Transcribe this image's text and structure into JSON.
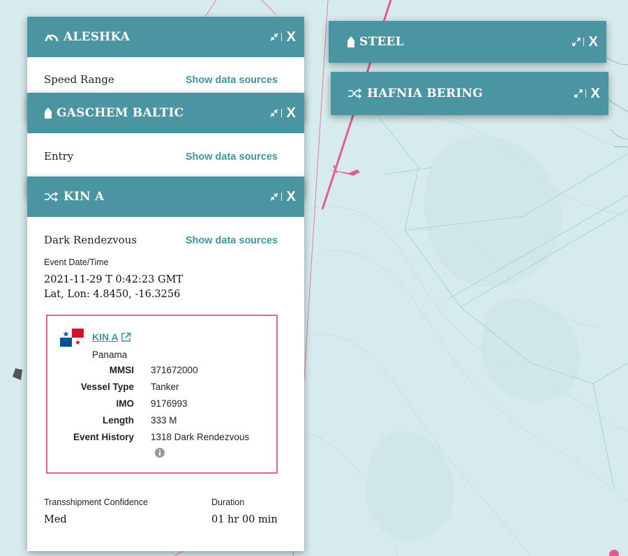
{
  "colors": {
    "header": "#4a95a1",
    "link": "#3f95a1",
    "highlight_border": "#e7609a",
    "map_water": "#d7eced"
  },
  "panels": {
    "aleshka": {
      "title": "ALESHKA",
      "icon": "speed-gauge-icon",
      "event_type": "Speed Range",
      "sources_link": "Show data sources",
      "close_label": "X"
    },
    "gaschem": {
      "title": "GASCHEM BALTIC",
      "icon": "vessel-marker-icon",
      "event_type": "Entry",
      "sources_link": "Show data sources",
      "close_label": "X"
    },
    "kin_a": {
      "title": "KIN A",
      "icon": "rendezvous-arrows-icon",
      "event_type": "Dark Rendezvous",
      "sources_link": "Show data sources",
      "close_label": "X",
      "event_datetime_label": "Event Date/Time",
      "event_datetime": "2021-11-29 T 0:42:23 GMT",
      "latlon": "Lat, Lon: 4.8450, -16.3256",
      "vessel": {
        "name": "KIN A",
        "flag_country": "Panama",
        "fields": [
          {
            "label": "MMSI",
            "value": "371672000"
          },
          {
            "label": "Vessel Type",
            "value": "Tanker"
          },
          {
            "label": "IMO",
            "value": "9176993"
          },
          {
            "label": "Length",
            "value": "333 M"
          },
          {
            "label": "Event History",
            "value": "1318 Dark Rendezvous"
          }
        ]
      },
      "confidence_label": "Transshipment Confidence",
      "confidence_value": "Med",
      "duration_label": "Duration",
      "duration_value": "01 hr 00 min"
    },
    "steel": {
      "title": "STEEL",
      "icon": "vessel-marker-icon",
      "close_label": "X"
    },
    "hafnia": {
      "title": "HAFNIA BERING",
      "icon": "rendezvous-arrows-icon",
      "close_label": "X"
    }
  }
}
